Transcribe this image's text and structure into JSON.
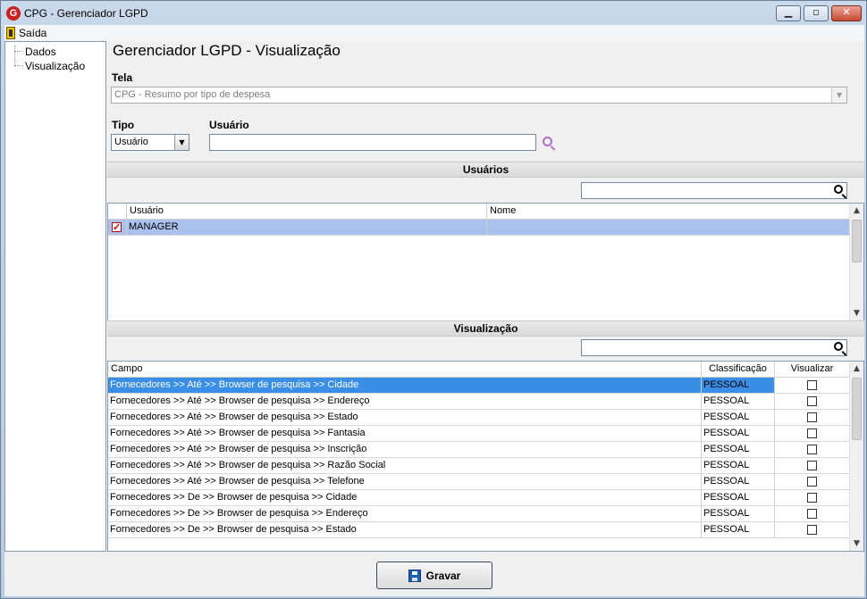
{
  "window": {
    "title": "CPG - Gerenciador LGPD",
    "app_icon": "G",
    "minimize": "▁",
    "maximize": "▫",
    "close": "✕"
  },
  "menu": {
    "exit_label": "Saída"
  },
  "tree": {
    "items": [
      "Dados",
      "Visualização"
    ]
  },
  "page": {
    "title": "Gerenciador LGPD - Visualização"
  },
  "form": {
    "tela_label": "Tela",
    "tela_value": "CPG - Resumo por tipo de despesa",
    "tipo_label": "Tipo",
    "tipo_value": "Usuário",
    "usuario_label": "Usuário",
    "usuario_value": ""
  },
  "usuarios_section": {
    "title": "Usuários",
    "search_value": "",
    "columns": [
      "Usuário",
      "Nome"
    ],
    "rows": [
      {
        "checked": true,
        "usuario": "MANAGER",
        "nome": ""
      }
    ]
  },
  "visualizacao_section": {
    "title": "Visualização",
    "search_value": "",
    "columns": [
      "Campo",
      "Classificação",
      "Visualizar"
    ],
    "rows": [
      {
        "campo": "Fornecedores >> Até >> Browser de pesquisa >> Cidade",
        "classificacao": "PESSOAL",
        "visualizar": false
      },
      {
        "campo": "Fornecedores >> Até >> Browser de pesquisa >> Endereço",
        "classificacao": "PESSOAL",
        "visualizar": false
      },
      {
        "campo": "Fornecedores >> Até >> Browser de pesquisa >> Estado",
        "classificacao": "PESSOAL",
        "visualizar": false
      },
      {
        "campo": "Fornecedores >> Até >> Browser de pesquisa >> Fantasia",
        "classificacao": "PESSOAL",
        "visualizar": false
      },
      {
        "campo": "Fornecedores >> Até >> Browser de pesquisa >> Inscrição",
        "classificacao": "PESSOAL",
        "visualizar": false
      },
      {
        "campo": "Fornecedores >> Até >> Browser de pesquisa >> Razão Social",
        "classificacao": "PESSOAL",
        "visualizar": false
      },
      {
        "campo": "Fornecedores >> Até >> Browser de pesquisa >> Telefone",
        "classificacao": "PESSOAL",
        "visualizar": false
      },
      {
        "campo": "Fornecedores >> De >> Browser de pesquisa >> Cidade",
        "classificacao": "PESSOAL",
        "visualizar": false
      },
      {
        "campo": "Fornecedores >> De >> Browser de pesquisa >> Endereço",
        "classificacao": "PESSOAL",
        "visualizar": false
      },
      {
        "campo": "Fornecedores >> De >> Browser de pesquisa >> Estado",
        "classificacao": "PESSOAL",
        "visualizar": false
      }
    ]
  },
  "footer": {
    "save_label": "Gravar"
  },
  "colors": {
    "selected_row": "#3a8ee6",
    "selected_user_row": "#a9c1ec",
    "search_accent": "#b36ec8"
  }
}
